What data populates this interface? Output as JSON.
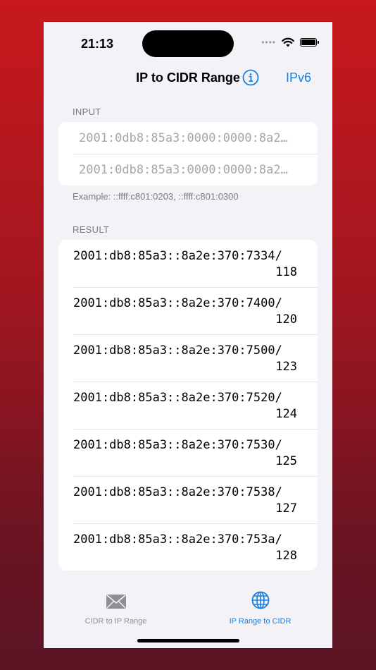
{
  "status": {
    "time": "21:13",
    "dots": "••••"
  },
  "nav": {
    "title": "IP to CIDR Range",
    "mode_button": "IPv6"
  },
  "input": {
    "section": "INPUT",
    "start_value": "2001:0db8:85a3:0000:0000:8a2…",
    "end_value": "2001:0db8:85a3:0000:0000:8a2…",
    "example": "Example: ::ffff:c801:0203, ::ffff:c801:0300"
  },
  "result": {
    "section": "RESULT",
    "rows": [
      {
        "line1": "2001:db8:85a3::8a2e:370:7334/",
        "line2": "118"
      },
      {
        "line1": "2001:db8:85a3::8a2e:370:7400/",
        "line2": "120"
      },
      {
        "line1": "2001:db8:85a3::8a2e:370:7500/",
        "line2": "123"
      },
      {
        "line1": "2001:db8:85a3::8a2e:370:7520/",
        "line2": "124"
      },
      {
        "line1": "2001:db8:85a3::8a2e:370:7530/",
        "line2": "125"
      },
      {
        "line1": "2001:db8:85a3::8a2e:370:7538/",
        "line2": "127"
      },
      {
        "line1": "2001:db8:85a3::8a2e:370:753a/",
        "line2": "128"
      }
    ]
  },
  "tabs": [
    {
      "label": "CIDR to IP Range",
      "icon": "envelope-icon",
      "active": false
    },
    {
      "label": "IP Range to CIDR",
      "icon": "globe-icon",
      "active": true
    }
  ],
  "colors": {
    "accent": "#1a7fe0",
    "inactive": "#8e8e93",
    "background": "#f2f2f7"
  }
}
